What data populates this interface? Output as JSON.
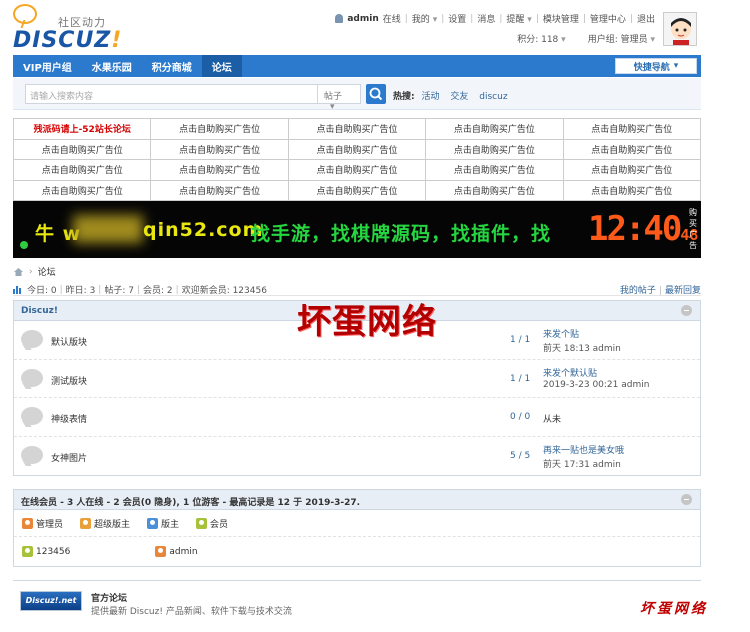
{
  "logo": {
    "sub": "社区动力",
    "main": "DISCUZ",
    "bang": "!"
  },
  "userbar": {
    "username": "admin",
    "status": "在线",
    "links": [
      "我的",
      "设置",
      "消息",
      "提醒",
      "模块管理",
      "管理中心",
      "退出"
    ],
    "credits": "积分: 118",
    "usergroup": "用户组: 管理员"
  },
  "nav": {
    "items": [
      "VIP用户组",
      "水果乐园",
      "积分商城",
      "论坛"
    ],
    "quicknav": "快捷导航"
  },
  "search": {
    "placeholder": "请输入搜索内容",
    "scope": "帖子",
    "hot_label": "热搜:",
    "hot_keywords": [
      "活动",
      "交友",
      "discuz"
    ]
  },
  "ads": {
    "first": "残派码请上-52站长论坛",
    "cell": "点击自助购买广告位"
  },
  "banner": {
    "text_left": "牛 w",
    "text_mid": "qin52.com",
    "text_right": "找手游，找棋牌源码，找插件，找",
    "clock": "12:40",
    "clock_small": "48",
    "vertical": "购买广告"
  },
  "breadcrumb": {
    "current": "论坛"
  },
  "stats": {
    "today": "今日: 0",
    "yesterday": "昨日: 3",
    "posts": "帖子: 7",
    "members": "会员: 2",
    "welcome": "欢迎新会员: 123456",
    "my_posts": "我的帖子",
    "latest": "最新回复"
  },
  "forum_box": {
    "title": "Discuz!",
    "forums": [
      {
        "name": "默认版块",
        "count": "1 / 1",
        "last_title": "来发个贴",
        "last_meta": "前天 18:13 admin"
      },
      {
        "name": "测试版块",
        "count": "1 / 1",
        "last_title": "来发个默认贴",
        "last_meta": "2019-3-23 00:21 admin"
      },
      {
        "name": "神级表情",
        "count": "0 / 0",
        "last_none": "从未"
      },
      {
        "name": "女神图片",
        "count": "5 / 5",
        "last_title": "再来一贴也是美女哦",
        "last_meta": "前天 17:31 admin"
      }
    ]
  },
  "online": {
    "title": "在线会员 - 3 人在线 - 2 会员(0 隐身), 1 位游客 - 最高记录是 12 于 2019-3-27.",
    "legend": [
      {
        "label": "管理员",
        "color": "#e8873a"
      },
      {
        "label": "超级版主",
        "color": "#e8a03a"
      },
      {
        "label": "版主",
        "color": "#4a8fd8"
      },
      {
        "label": "会员",
        "color": "#a5c23a"
      }
    ],
    "users": [
      {
        "label": "123456",
        "color": "#a5c23a"
      },
      {
        "label": "admin",
        "color": "#e8873a"
      }
    ]
  },
  "links": {
    "logo_text": "Discuz!.net",
    "title": "官方论坛",
    "desc": "提供最新 Discuz! 产品新闻、软件下载与技术交流"
  },
  "watermark": {
    "big": "坏蛋网络",
    "small": "坏蛋网络"
  }
}
